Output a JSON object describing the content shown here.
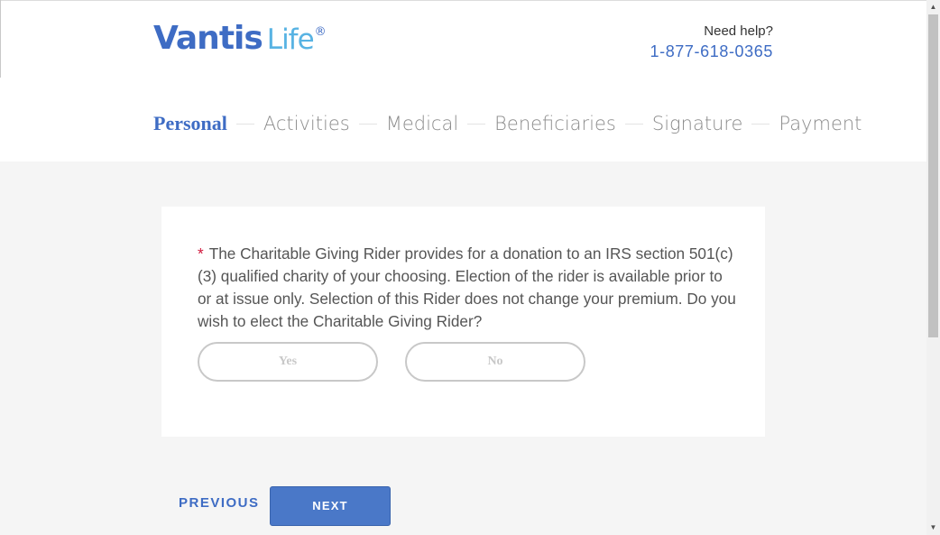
{
  "logo": {
    "word1": "Vantis",
    "word2": "Life",
    "registered": "®"
  },
  "help": {
    "label": "Need help?",
    "phone": "1-877-618-0365"
  },
  "steps": [
    {
      "label": "Personal",
      "active": true
    },
    {
      "label": "Activities",
      "active": false
    },
    {
      "label": "Medical",
      "active": false
    },
    {
      "label": "Beneficiaries",
      "active": false
    },
    {
      "label": "Signature",
      "active": false
    },
    {
      "label": "Payment",
      "active": false
    }
  ],
  "question": {
    "required_marker": "*",
    "text": "The Charitable Giving Rider provides for a donation to an IRS section 501(c)(3) qualified charity of your choosing. Election of the rider is available prior to or at issue only. Selection of this Rider does not change your premium. Do you wish to elect the Charitable Giving Rider?",
    "options": {
      "yes": "Yes",
      "no": "No"
    },
    "selected": null
  },
  "nav": {
    "previous": "PREVIOUS",
    "next": "NEXT"
  },
  "scrollbar": {
    "up_icon": "▲",
    "down_icon": "▼"
  },
  "colors": {
    "brand_blue": "#3e6cc4",
    "brand_light_blue": "#58b3e3",
    "required_red": "#d0173b",
    "next_button": "#4a78c8",
    "page_background": "#f5f5f5"
  }
}
